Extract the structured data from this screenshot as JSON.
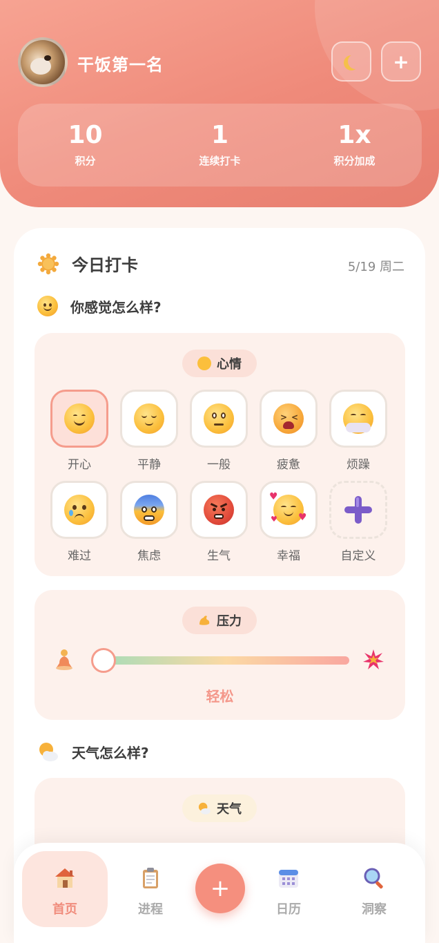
{
  "header": {
    "username": "干饭第一名",
    "stats": [
      {
        "value": "10",
        "label": "积分"
      },
      {
        "value": "1",
        "label": "连续打卡"
      },
      {
        "value": "1x",
        "label": "积分加成"
      }
    ],
    "plus_label": "+"
  },
  "checkin": {
    "title": "今日打卡",
    "date": "5/19 周二",
    "mood_question": "你感觉怎么样?",
    "mood_pill": "心情",
    "moods": [
      {
        "label": "开心",
        "selected": true,
        "color": "#fbbf3c"
      },
      {
        "label": "平静",
        "selected": false,
        "color": "#fbbf3c"
      },
      {
        "label": "一般",
        "selected": false,
        "color": "#fbbf3c"
      },
      {
        "label": "疲惫",
        "selected": false,
        "color": "#f3a03a"
      },
      {
        "label": "烦躁",
        "selected": false,
        "color": "#f7b64a"
      },
      {
        "label": "难过",
        "selected": false,
        "color": "#fbbf3c"
      },
      {
        "label": "焦虑",
        "selected": false,
        "color": "#5a8fe0"
      },
      {
        "label": "生气",
        "selected": false,
        "color": "#e24b3b"
      },
      {
        "label": "幸福",
        "selected": false,
        "color": "#fbbf3c"
      },
      {
        "label": "自定义",
        "selected": false,
        "color": "#7b5cc9"
      }
    ],
    "stress_pill": "压力",
    "stress_value_label": "轻松",
    "stress_level": 0,
    "weather_question": "天气怎么样?",
    "weather_pill": "天气"
  },
  "nav": {
    "items": [
      {
        "label": "首页",
        "active": true
      },
      {
        "label": "进程",
        "active": false
      },
      {
        "label": "日历",
        "active": false
      },
      {
        "label": "洞察",
        "active": false
      }
    ],
    "fab_label": "+"
  },
  "colors": {
    "accent": "#f08c7c",
    "header_gradient_start": "#f7a392",
    "header_gradient_end": "#e77e6f"
  }
}
